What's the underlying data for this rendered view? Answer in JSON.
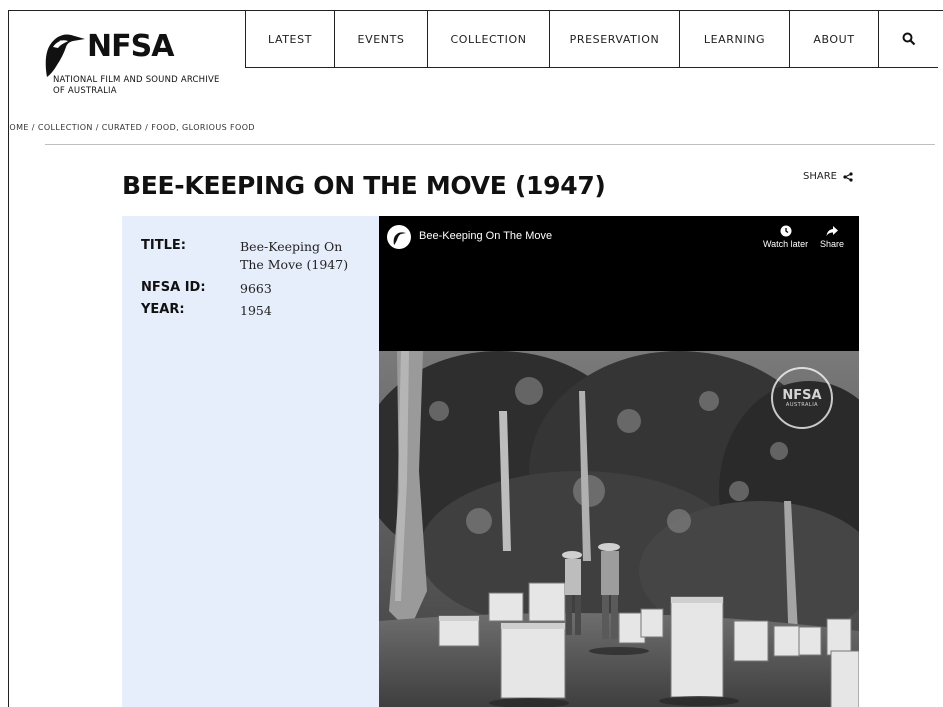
{
  "header": {
    "logo_text": "NFSA",
    "logo_subtitle_line1": "NATIONAL FILM AND SOUND ARCHIVE",
    "logo_subtitle_line2": "OF AUSTRALIA",
    "nav": [
      {
        "label": "LATEST"
      },
      {
        "label": "EVENTS"
      },
      {
        "label": "COLLECTION"
      },
      {
        "label": "PRESERVATION"
      },
      {
        "label": "LEARNING"
      },
      {
        "label": "ABOUT"
      }
    ],
    "search_icon": "search-icon"
  },
  "breadcrumb": "HOME / COLLECTION / CURATED / FOOD, GLORIOUS FOOD",
  "page": {
    "title": "BEE-KEEPING ON THE MOVE (1947)",
    "share_label": "SHARE",
    "share_icon": "share-icon"
  },
  "details": {
    "title_label": "TITLE:",
    "title_value": "Bee-Keeping On The Move (1947)",
    "id_label": "NFSA ID:",
    "id_value": "9663",
    "year_label": "YEAR:",
    "year_value": "1954"
  },
  "video": {
    "title": "Bee-Keeping On The Move",
    "watch_later_label": "Watch later",
    "share_label": "Share",
    "watermark": "NFSA",
    "watermark_sub": "AUSTRALIA"
  },
  "colors": {
    "details_bg": "#e6eefc",
    "video_bg": "#000000",
    "text": "#111111"
  }
}
